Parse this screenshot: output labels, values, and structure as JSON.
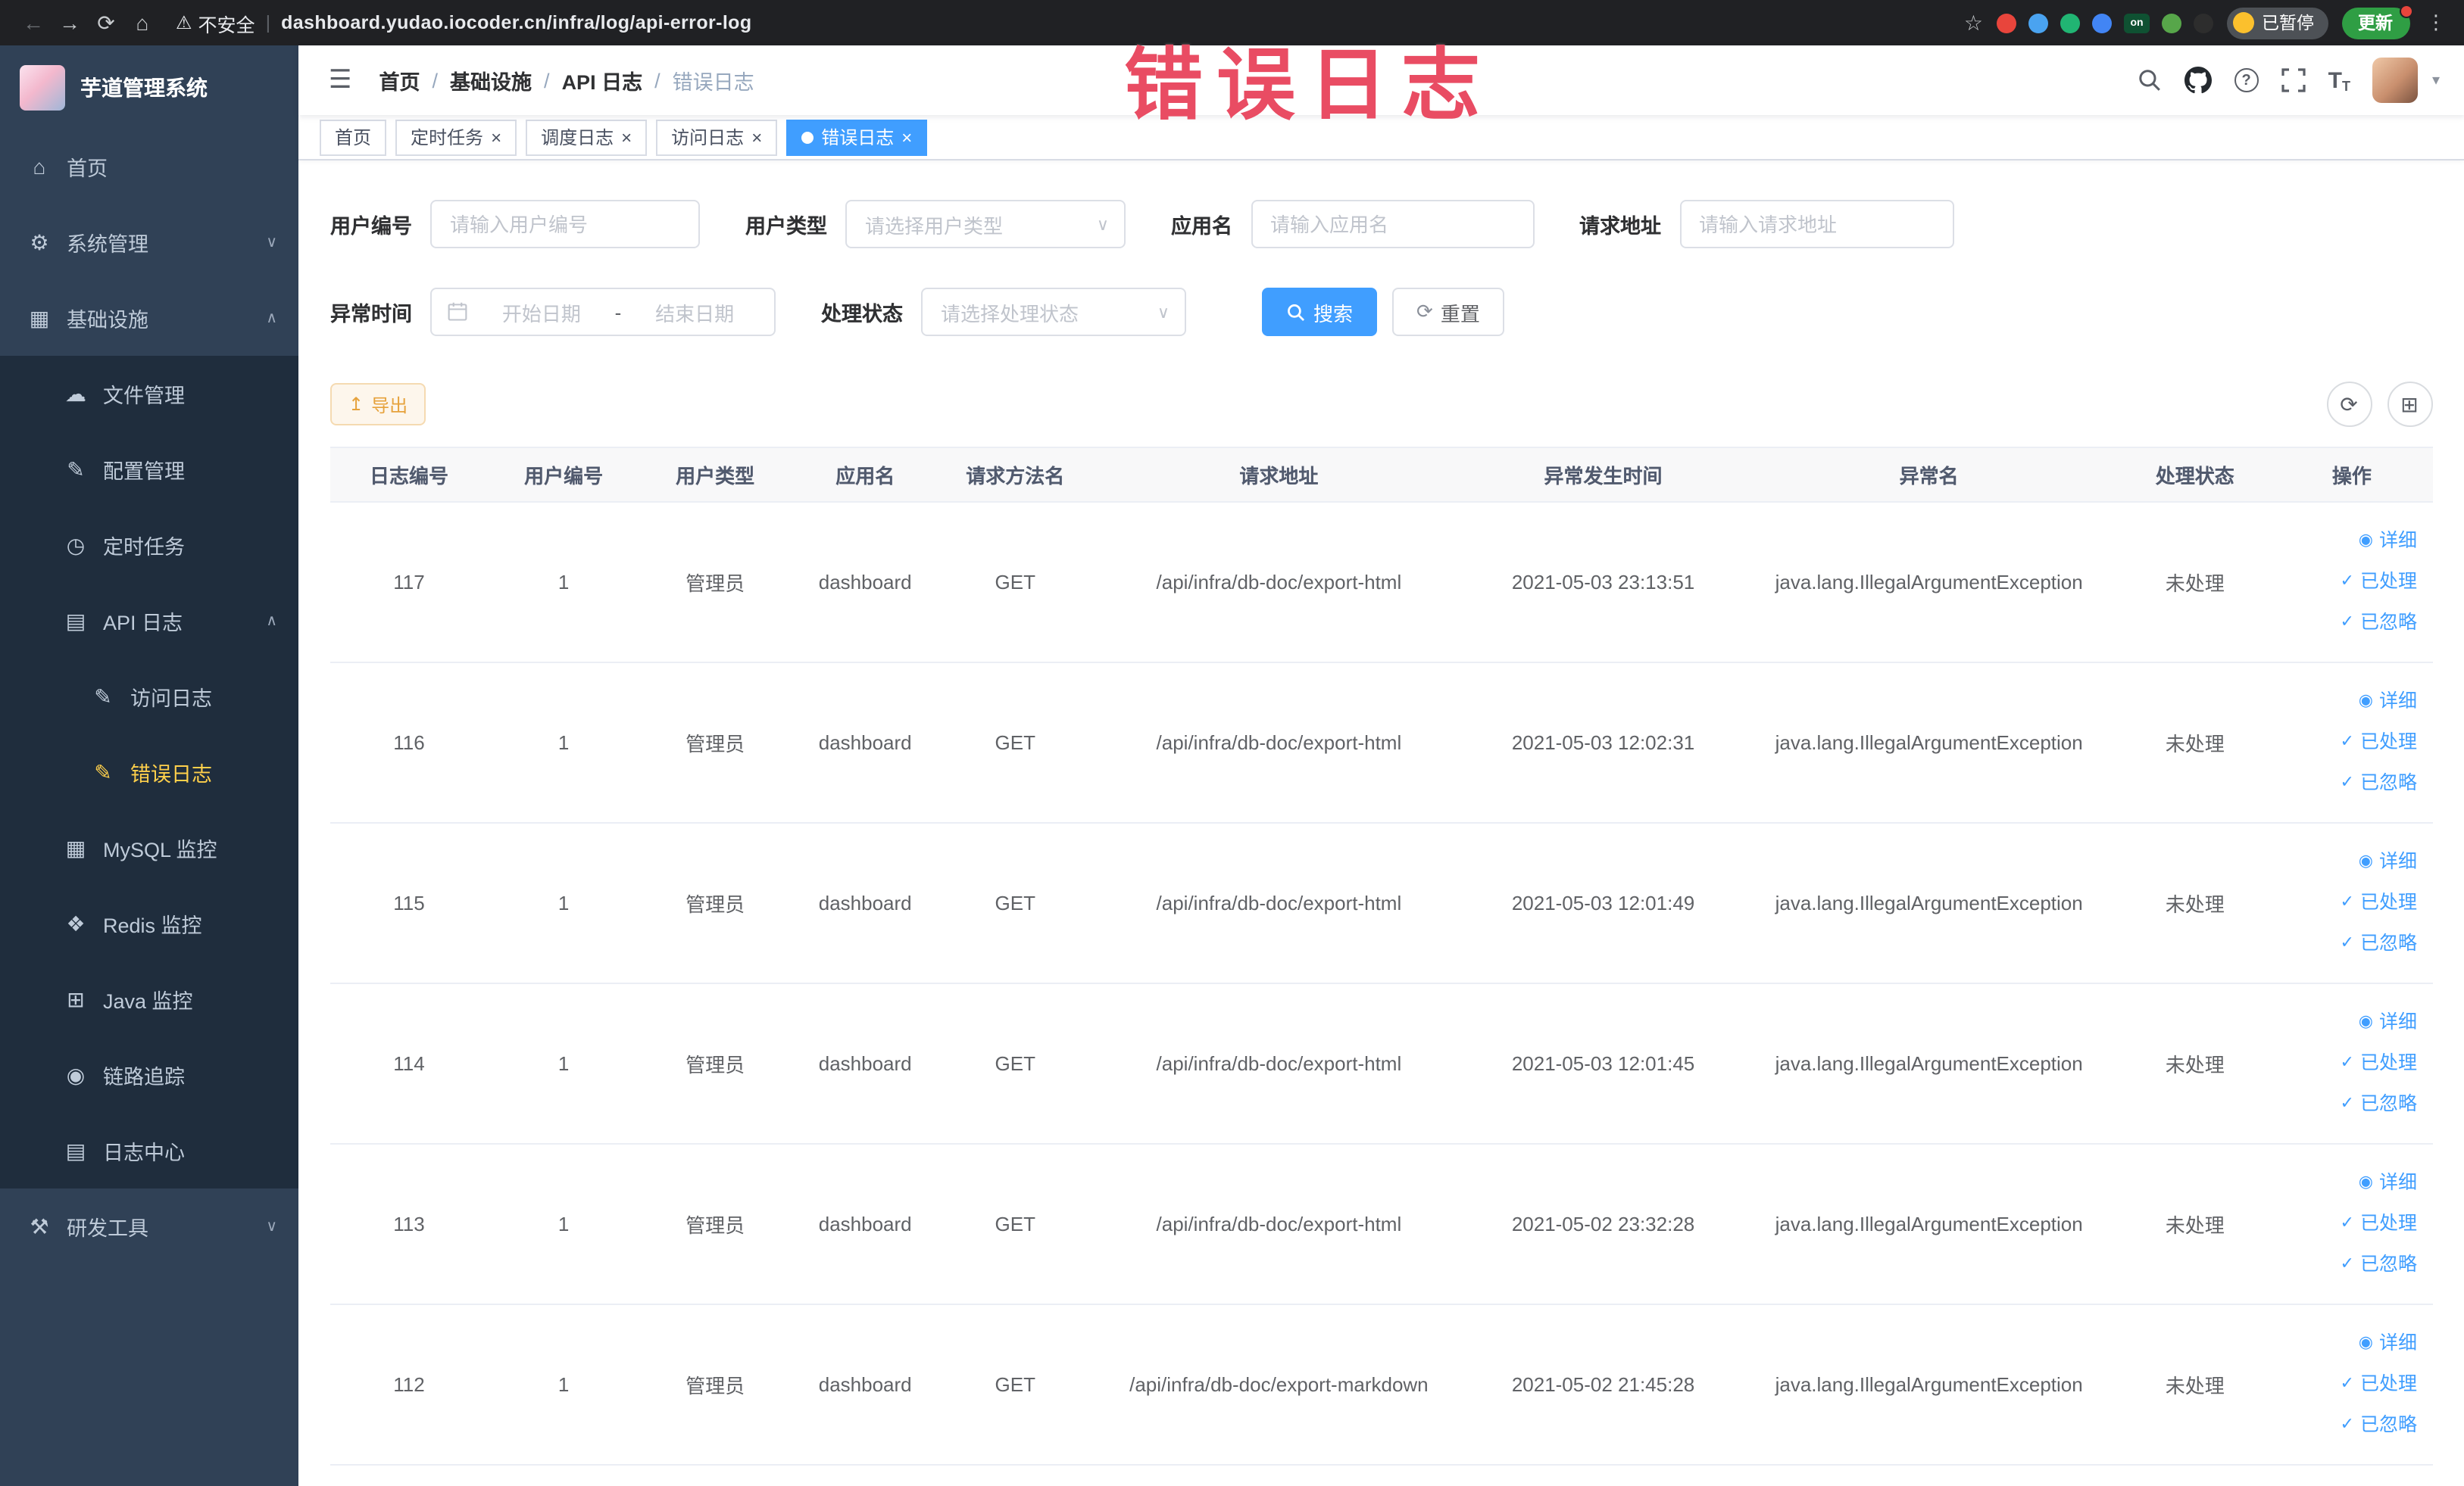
{
  "browser": {
    "security_label": "不安全",
    "url": "dashboard.yudao.iocoder.cn/infra/log/api-error-log",
    "paused_badge": "已暂停",
    "update_button": "更新",
    "extensions": [
      {
        "name": "extension-red-icon",
        "color": "#e8453c"
      },
      {
        "name": "extension-blue-drop-icon",
        "color": "#4aa3f0"
      },
      {
        "name": "extension-green-circle-icon",
        "color": "#21b573"
      },
      {
        "name": "extension-grid-icon",
        "color": "#4285f4"
      },
      {
        "name": "extension-on-badge-icon",
        "color": "#0f5132",
        "label": "on"
      },
      {
        "name": "extension-leaf-icon",
        "color": "#57a64a"
      },
      {
        "name": "extension-paw-icon",
        "color": "#2d2d2d"
      }
    ]
  },
  "annotation": "错误日志",
  "sidebar": {
    "logo_title": "芋道管理系统",
    "items": [
      {
        "label": "首页",
        "icon": "home-icon",
        "level": 1
      },
      {
        "label": "系统管理",
        "icon": "gear-icon",
        "level": 1,
        "chevron": "down"
      },
      {
        "label": "基础设施",
        "icon": "infrastructure-icon",
        "level": 1,
        "chevron": "up"
      },
      {
        "label": "文件管理",
        "icon": "file-icon",
        "level": 2
      },
      {
        "label": "配置管理",
        "icon": "config-icon",
        "level": 2
      },
      {
        "label": "定时任务",
        "icon": "timer-icon",
        "level": 2
      },
      {
        "label": "API 日志",
        "icon": "api-log-icon",
        "level": 2,
        "chevron": "up"
      },
      {
        "label": "访问日志",
        "icon": "access-log-icon",
        "level": 3
      },
      {
        "label": "错误日志",
        "icon": "error-log-icon",
        "level": 3,
        "active": true
      },
      {
        "label": "MySQL 监控",
        "icon": "mysql-icon",
        "level": 2
      },
      {
        "label": "Redis 监控",
        "icon": "redis-icon",
        "level": 2
      },
      {
        "label": "Java 监控",
        "icon": "java-icon",
        "level": 2
      },
      {
        "label": "链路追踪",
        "icon": "trace-icon",
        "level": 2
      },
      {
        "label": "日志中心",
        "icon": "log-center-icon",
        "level": 2
      },
      {
        "label": "研发工具",
        "icon": "tools-icon",
        "level": 1,
        "chevron": "down"
      }
    ]
  },
  "header": {
    "breadcrumb": [
      "首页",
      "基础设施",
      "API 日志",
      "错误日志"
    ]
  },
  "tabs": [
    {
      "label": "首页",
      "closable": false,
      "active": false
    },
    {
      "label": "定时任务",
      "closable": true,
      "active": false
    },
    {
      "label": "调度日志",
      "closable": true,
      "active": false
    },
    {
      "label": "访问日志",
      "closable": true,
      "active": false
    },
    {
      "label": "错误日志",
      "closable": true,
      "active": true
    }
  ],
  "filters": {
    "user_id_label": "用户编号",
    "user_id_placeholder": "请输入用户编号",
    "user_type_label": "用户类型",
    "user_type_placeholder": "请选择用户类型",
    "app_name_label": "应用名",
    "app_name_placeholder": "请输入应用名",
    "request_url_label": "请求地址",
    "request_url_placeholder": "请输入请求地址",
    "time_label": "异常时间",
    "time_start_placeholder": "开始日期",
    "time_separator": "-",
    "time_end_placeholder": "结束日期",
    "status_label": "处理状态",
    "status_placeholder": "请选择处理状态",
    "search_button": "搜索",
    "reset_button": "重置"
  },
  "toolbar": {
    "export_label": "导出"
  },
  "table": {
    "columns": [
      "日志编号",
      "用户编号",
      "用户类型",
      "应用名",
      "请求方法名",
      "请求地址",
      "异常发生时间",
      "异常名",
      "处理状态",
      "操作"
    ],
    "row_actions": [
      "详细",
      "已处理",
      "已忽略"
    ],
    "rows": [
      {
        "id": "117",
        "userId": "1",
        "userType": "管理员",
        "app": "dashboard",
        "method": "GET",
        "url": "/api/infra/db-doc/export-html",
        "time": "2021-05-03 23:13:51",
        "exception": "java.lang.IllegalArgumentException",
        "status": "未处理"
      },
      {
        "id": "116",
        "userId": "1",
        "userType": "管理员",
        "app": "dashboard",
        "method": "GET",
        "url": "/api/infra/db-doc/export-html",
        "time": "2021-05-03 12:02:31",
        "exception": "java.lang.IllegalArgumentException",
        "status": "未处理"
      },
      {
        "id": "115",
        "userId": "1",
        "userType": "管理员",
        "app": "dashboard",
        "method": "GET",
        "url": "/api/infra/db-doc/export-html",
        "time": "2021-05-03 12:01:49",
        "exception": "java.lang.IllegalArgumentException",
        "status": "未处理"
      },
      {
        "id": "114",
        "userId": "1",
        "userType": "管理员",
        "app": "dashboard",
        "method": "GET",
        "url": "/api/infra/db-doc/export-html",
        "time": "2021-05-03 12:01:45",
        "exception": "java.lang.IllegalArgumentException",
        "status": "未处理"
      },
      {
        "id": "113",
        "userId": "1",
        "userType": "管理员",
        "app": "dashboard",
        "method": "GET",
        "url": "/api/infra/db-doc/export-html",
        "time": "2021-05-02 23:32:28",
        "exception": "java.lang.IllegalArgumentException",
        "status": "未处理"
      },
      {
        "id": "112",
        "userId": "1",
        "userType": "管理员",
        "app": "dashboard",
        "method": "GET",
        "url": "/api/infra/db-doc/export-markdown",
        "time": "2021-05-02 21:45:28",
        "exception": "java.lang.IllegalArgumentException",
        "status": "未处理"
      }
    ]
  },
  "icons": {
    "back-icon": "←",
    "forward-icon": "→",
    "reload-icon": "⟳",
    "browser-home-icon": "⌂",
    "warning-icon": "⚠",
    "star-icon": "☆",
    "overflow-menu-icon": "⋮",
    "hamburger-icon": "☰",
    "chevron-down-icon": "∨",
    "chevron-up-icon": "∧",
    "caret-down-icon": "▾",
    "home-icon": "⌂",
    "gear-icon": "⚙",
    "infrastructure-icon": "▦",
    "file-icon": "☁",
    "config-icon": "✎",
    "timer-icon": "◷",
    "api-log-icon": "▤",
    "access-log-icon": "✎",
    "error-log-icon": "✎",
    "mysql-icon": "▦",
    "redis-icon": "❖",
    "java-icon": "⊞",
    "trace-icon": "◉",
    "log-center-icon": "▤",
    "tools-icon": "⚒",
    "refresh-icon": "⟳",
    "columns-icon": "⊞",
    "export-icon": "↥",
    "eye-icon": "◉",
    "check-icon": "✓",
    "close-icon": "×"
  }
}
